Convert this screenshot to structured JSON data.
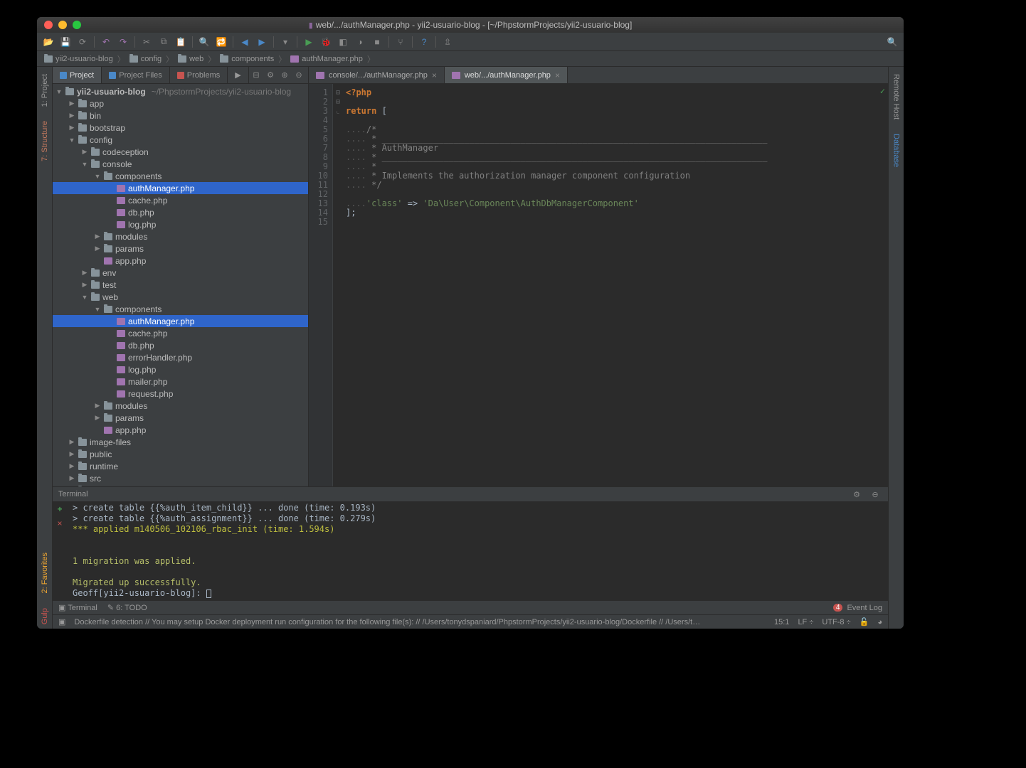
{
  "window": {
    "title_prefix": "web/.../authManager.php - yii2-usuario-blog - [~/PhpstormProjects/yii2-usuario-blog]"
  },
  "breadcrumb": {
    "items": [
      "yii2-usuario-blog",
      "config",
      "web",
      "components",
      "authManager.php"
    ]
  },
  "project_tabs": {
    "project": "Project",
    "project_files": "Project Files",
    "problems": "Problems"
  },
  "tree": {
    "root": {
      "name": "yii2-usuario-blog",
      "path": "~/PhpstormProjects/yii2-usuario-blog"
    },
    "nodes": [
      {
        "indent": 1,
        "arrow": "▶",
        "icon": "folder",
        "label": "app"
      },
      {
        "indent": 1,
        "arrow": "▶",
        "icon": "folder",
        "label": "bin"
      },
      {
        "indent": 1,
        "arrow": "▶",
        "icon": "folder",
        "label": "bootstrap"
      },
      {
        "indent": 1,
        "arrow": "▼",
        "icon": "folder",
        "label": "config"
      },
      {
        "indent": 2,
        "arrow": "▶",
        "icon": "folder",
        "label": "codeception"
      },
      {
        "indent": 2,
        "arrow": "▼",
        "icon": "folder",
        "label": "console"
      },
      {
        "indent": 3,
        "arrow": "▼",
        "icon": "folder",
        "label": "components"
      },
      {
        "indent": 4,
        "arrow": "",
        "icon": "php",
        "label": "authManager.php",
        "selected": true
      },
      {
        "indent": 4,
        "arrow": "",
        "icon": "php",
        "label": "cache.php"
      },
      {
        "indent": 4,
        "arrow": "",
        "icon": "php",
        "label": "db.php"
      },
      {
        "indent": 4,
        "arrow": "",
        "icon": "php",
        "label": "log.php"
      },
      {
        "indent": 3,
        "arrow": "▶",
        "icon": "folder",
        "label": "modules"
      },
      {
        "indent": 3,
        "arrow": "▶",
        "icon": "folder",
        "label": "params"
      },
      {
        "indent": 3,
        "arrow": "",
        "icon": "php",
        "label": "app.php"
      },
      {
        "indent": 2,
        "arrow": "▶",
        "icon": "folder",
        "label": "env"
      },
      {
        "indent": 2,
        "arrow": "▶",
        "icon": "folder",
        "label": "test"
      },
      {
        "indent": 2,
        "arrow": "▼",
        "icon": "folder",
        "label": "web"
      },
      {
        "indent": 3,
        "arrow": "▼",
        "icon": "folder",
        "label": "components"
      },
      {
        "indent": 4,
        "arrow": "",
        "icon": "php",
        "label": "authManager.php",
        "selected": true
      },
      {
        "indent": 4,
        "arrow": "",
        "icon": "php",
        "label": "cache.php"
      },
      {
        "indent": 4,
        "arrow": "",
        "icon": "php",
        "label": "db.php"
      },
      {
        "indent": 4,
        "arrow": "",
        "icon": "php",
        "label": "errorHandler.php"
      },
      {
        "indent": 4,
        "arrow": "",
        "icon": "php",
        "label": "log.php"
      },
      {
        "indent": 4,
        "arrow": "",
        "icon": "php",
        "label": "mailer.php"
      },
      {
        "indent": 4,
        "arrow": "",
        "icon": "php",
        "label": "request.php"
      },
      {
        "indent": 3,
        "arrow": "▶",
        "icon": "folder",
        "label": "modules"
      },
      {
        "indent": 3,
        "arrow": "▶",
        "icon": "folder",
        "label": "params"
      },
      {
        "indent": 3,
        "arrow": "",
        "icon": "php",
        "label": "app.php"
      },
      {
        "indent": 1,
        "arrow": "▶",
        "icon": "folder",
        "label": "image-files"
      },
      {
        "indent": 1,
        "arrow": "▶",
        "icon": "folder",
        "label": "public"
      },
      {
        "indent": 1,
        "arrow": "▶",
        "icon": "folder",
        "label": "runtime"
      },
      {
        "indent": 1,
        "arrow": "▶",
        "icon": "folder",
        "label": "src"
      },
      {
        "indent": 1,
        "arrow": "▶",
        "icon": "folder",
        "label": "tests"
      }
    ]
  },
  "editor_tabs": [
    {
      "label": "console/.../authManager.php",
      "active": false
    },
    {
      "label": "web/.../authManager.php",
      "active": true
    }
  ],
  "editor": {
    "line_count": 15,
    "lines": [
      {
        "type": "tag",
        "text": "<?php"
      },
      {
        "type": "blank",
        "text": ""
      },
      {
        "type": "return",
        "text": "return ["
      },
      {
        "type": "blank",
        "text": ""
      },
      {
        "type": "comment",
        "pre": "....",
        "text": "/*"
      },
      {
        "type": "comment",
        "pre": "....",
        "text": " * ___________________________________________________________________________"
      },
      {
        "type": "comment",
        "pre": "....",
        "text": " * AuthManager"
      },
      {
        "type": "comment",
        "pre": "....",
        "text": " * ___________________________________________________________________________"
      },
      {
        "type": "comment",
        "pre": "....",
        "text": " *"
      },
      {
        "type": "comment",
        "pre": "....",
        "text": " * Implements the authorization manager component configuration"
      },
      {
        "type": "comment",
        "pre": "....",
        "text": " */"
      },
      {
        "type": "blank",
        "text": ""
      },
      {
        "type": "assign",
        "pre": "....",
        "key": "'class'",
        "arrow": " => ",
        "val": "'Da\\User\\Component\\AuthDbManagerComponent'"
      },
      {
        "type": "close",
        "text": "];"
      },
      {
        "type": "blank",
        "text": ""
      }
    ]
  },
  "terminal": {
    "title": "Terminal",
    "lines": [
      {
        "cls": "l-gray",
        "text": "    > create table {{%auth_item_child}} ... done (time: 0.193s)"
      },
      {
        "cls": "l-gray",
        "text": "    > create table {{%auth_assignment}} ... done (time: 0.279s)"
      },
      {
        "cls": "l-yellow2",
        "text": "*** applied m140506_102106_rbac_init (time: 1.594s)"
      },
      {
        "cls": "l-gray",
        "text": ""
      },
      {
        "cls": "l-gray",
        "text": ""
      },
      {
        "cls": "l-yellow",
        "text": "1 migration was applied."
      },
      {
        "cls": "l-gray",
        "text": ""
      },
      {
        "cls": "l-yellow",
        "text": "Migrated up successfully."
      }
    ],
    "prompt": "Geoff[yii2-usuario-blog]:"
  },
  "bottom_tabs": {
    "terminal": "Terminal",
    "todo": "6: TODO",
    "event_log": "Event Log",
    "event_badge": "4"
  },
  "left_tools": {
    "project": "1: Project",
    "structure": "7: Structure",
    "favorites": "2: Favorites",
    "gulp": "Gulp"
  },
  "right_tools": {
    "remote": "Remote Host",
    "database": "Database"
  },
  "status": {
    "message": "Dockerfile detection  // You may setup Docker deployment run configuration for the following file(s): // /Users/tonydspaniard/PhpstormProjects/yii2-usuario-blog/Dockerfile // /Users/tonydspaniard/PhpstormProjects/y…",
    "caret": "15:1",
    "lineending": "LF",
    "encoding": "UTF-8"
  }
}
